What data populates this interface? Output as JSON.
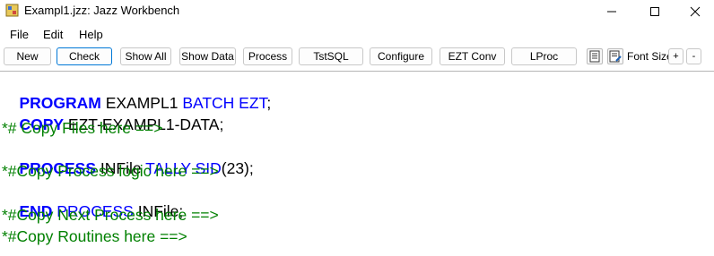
{
  "window": {
    "title": "Exampl1.jzz: Jazz Workbench"
  },
  "menu": [
    "File",
    "Edit",
    "Help"
  ],
  "toolbar": {
    "buttons": [
      "New",
      "Check",
      "Show All",
      "Show Data",
      "Process",
      "TstSQL",
      "Configure",
      "EZT Conv",
      "LProc"
    ],
    "font_size_label": "Font Size",
    "plus": "+",
    "minus": "-"
  },
  "icons": [
    "app-icon",
    "minimize-icon",
    "maximize-icon",
    "close-icon",
    "document-icon",
    "document-edit-icon"
  ],
  "colors": {
    "keyword": "#0000ff",
    "comment": "#008000",
    "text": "#000000",
    "focus": "#0078d7"
  },
  "code": {
    "l1": {
      "a": "PROGRAM",
      "b": " EXAMPL1 ",
      "c": "BATCH EZT",
      "d": ";"
    },
    "l2": {
      "a": "COPY",
      "b": " EZT-EXAMPL1-DATA;"
    },
    "l3": "*# Copy Files here ==>",
    "l4": {
      "a": "PROCESS",
      "b": " INFile ",
      "c": "TALLY SID",
      "d": "(23);"
    },
    "l5": "*#Copy Process logic here ==>",
    "l6": {
      "a": "END",
      "b": " PROCESS",
      "c": " INFile;"
    },
    "l7": "*#Copy Next Process here ==>",
    "l8": "*#Copy Routines here ==>"
  }
}
